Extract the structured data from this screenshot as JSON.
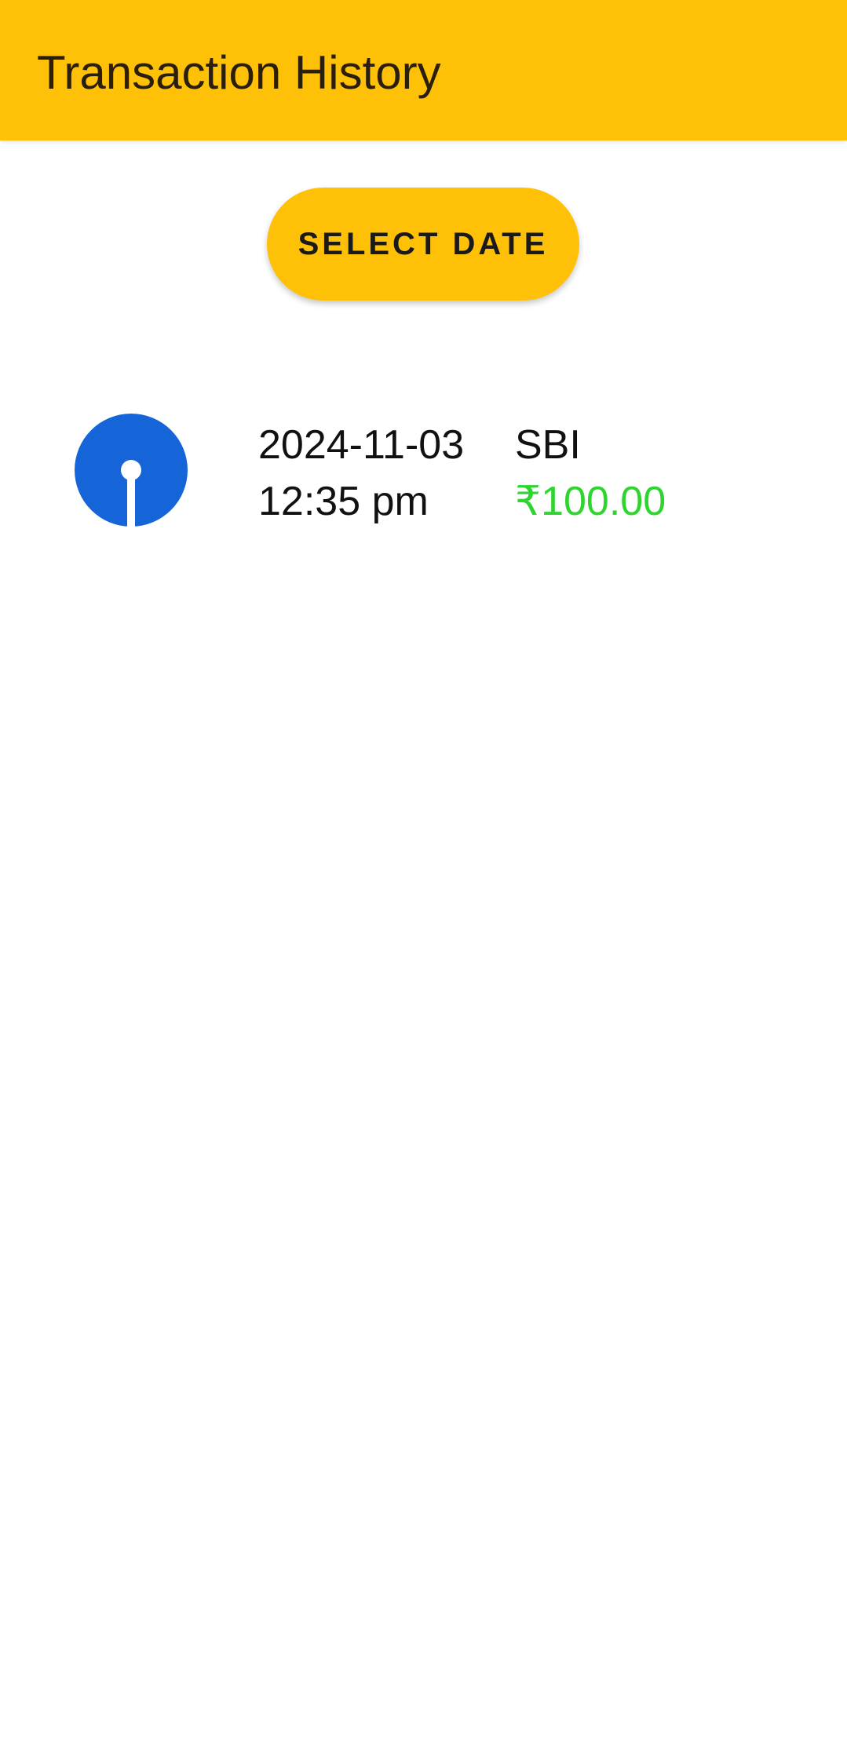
{
  "app_bar": {
    "title": "Transaction History",
    "color": "#FFC107"
  },
  "select_date_button": {
    "label": "SELECT DATE"
  },
  "transactions": [
    {
      "bank_logo_icon": "sbi-logo-icon",
      "date": "2024-11-03",
      "time": "12:35 pm",
      "bank": "SBI",
      "amount": "₹100.00",
      "amount_color": "#2ED52E"
    }
  ],
  "colors": {
    "accent": "#FFC107",
    "logo_blue": "#1565D8",
    "credit_green": "#2ED52E"
  }
}
